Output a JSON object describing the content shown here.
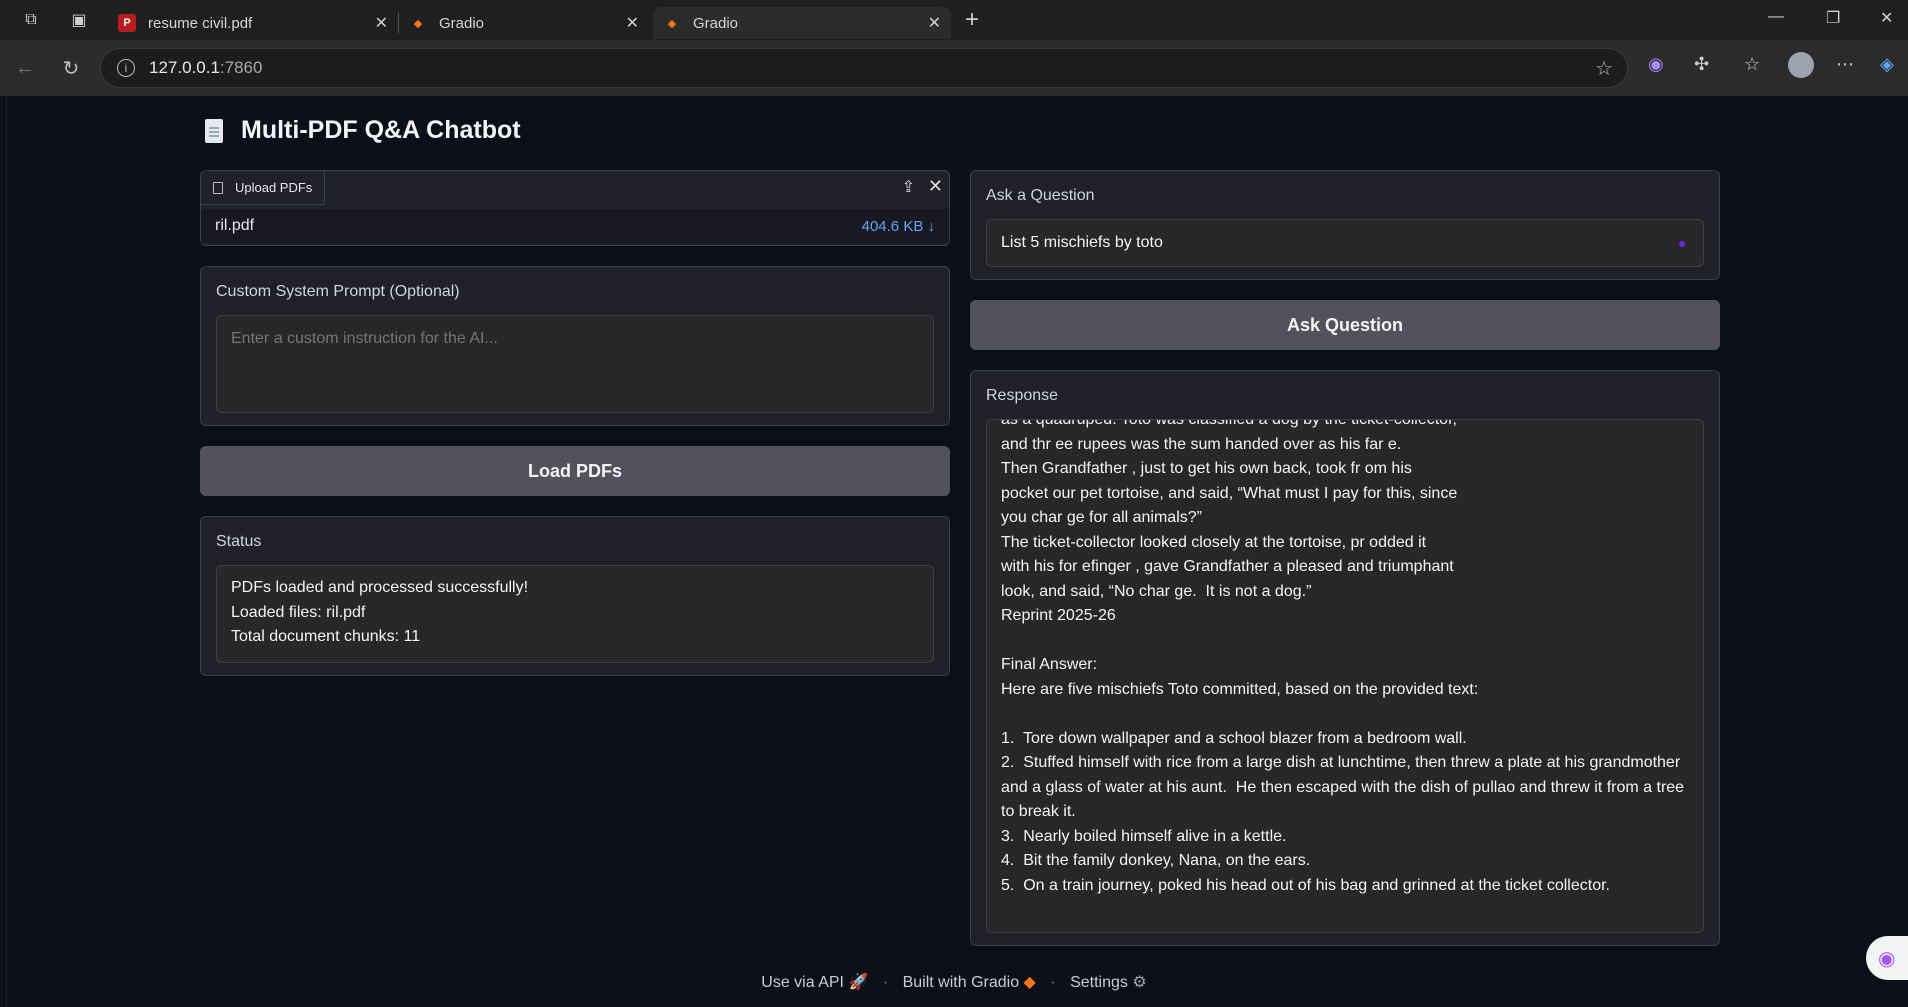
{
  "browser": {
    "tabs": [
      {
        "title": "resume civil.pdf",
        "favicon": "pdf-icon",
        "active": false
      },
      {
        "title": "Gradio",
        "favicon": "gradio-logo-icon",
        "active": false
      },
      {
        "title": "Gradio",
        "favicon": "gradio-logo-icon",
        "active": true
      }
    ],
    "url_host": "127.0.0.1",
    "url_port": ":7860"
  },
  "app": {
    "title": "Multi-PDF Q&A Chatbot"
  },
  "upload": {
    "tab_label": "Upload PDFs",
    "file_name": "ril.pdf",
    "file_size": "404.6 KB ↓"
  },
  "system_prompt": {
    "label": "Custom System Prompt (Optional)",
    "placeholder": "Enter a custom instruction for the AI...",
    "value": ""
  },
  "load_button": "Load PDFs",
  "status": {
    "label": "Status",
    "text": "PDFs loaded and processed successfully!\nLoaded files: ril.pdf\nTotal document chunks: 11"
  },
  "question": {
    "label": "Ask a Question",
    "value": "List 5 mischiefs by toto"
  },
  "ask_button": "Ask Question",
  "response": {
    "label": "Response",
    "text": "as a quadruped. Toto was classified a dog by the ticket-collector,\nand thr ee rupees was the sum handed over as his far e.\nThen Grandfather , just to get his own back, took fr om his\npocket our pet tortoise, and said, “What must I pay for this, since\nyou char ge for all animals?”\nThe ticket-collector looked closely at the tortoise, pr odded it\nwith his for efinger , gave Grandfather a pleased and triumphant\nlook, and said, “No char ge.  It is not a dog.”\nReprint 2025-26\n\nFinal Answer:\nHere are five mischiefs Toto committed, based on the provided text:\n\n1.  Tore down wallpaper and a school blazer from a bedroom wall.\n2.  Stuffed himself with rice from a large dish at lunchtime, then threw a plate at his grandmother and a glass of water at his aunt.  He then escaped with the dish of pullao and threw it from a tree to break it.\n3.  Nearly boiled himself alive in a kettle.\n4.  Bit the family donkey, Nana, on the ears.\n5.  On a train journey, poked his head out of his bag and grinned at the ticket collector."
  },
  "footer": {
    "api": "Use via API",
    "built": "Built with Gradio",
    "settings": "Settings"
  }
}
